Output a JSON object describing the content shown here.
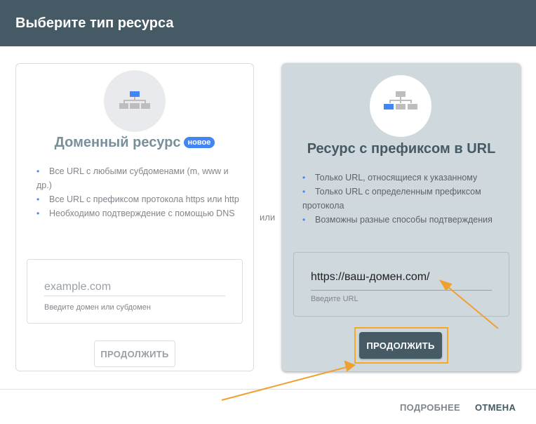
{
  "dialog": {
    "title": "Выберите тип ресурса"
  },
  "domain_property": {
    "title": "Доменный ресурс",
    "badge": "новое",
    "features": [
      "Все URL с любыми субдоменами (m, www и др.)",
      "Все URL с префиксом протокола https или http",
      "Необходимо подтверждение с помощью DNS"
    ],
    "input_placeholder": "example.com",
    "input_helper": "Введите домен или субдомен",
    "continue_label": "ПРОДОЛЖИТЬ",
    "icon": "sitemap-icon"
  },
  "or_label": "или",
  "url_prefix_property": {
    "title": "Ресурс с префиксом в URL",
    "features": [
      "Только URL, относящиеся к указанному",
      "Только URL с определенным префиксом протокола",
      "Возможны разные способы подтверждения"
    ],
    "input_value": "https://ваш-домен.com/",
    "input_helper": "Введите URL",
    "continue_label": "ПРОДОЛЖИТЬ",
    "icon": "sitemap-icon"
  },
  "footer": {
    "more_label": "ПОДРОБНЕЕ",
    "cancel_label": "ОТМЕНА"
  },
  "colors": {
    "header": "#455a64",
    "accent": "#4285f4",
    "highlight": "#f9a825",
    "selected_card": "#cfd8dc"
  }
}
